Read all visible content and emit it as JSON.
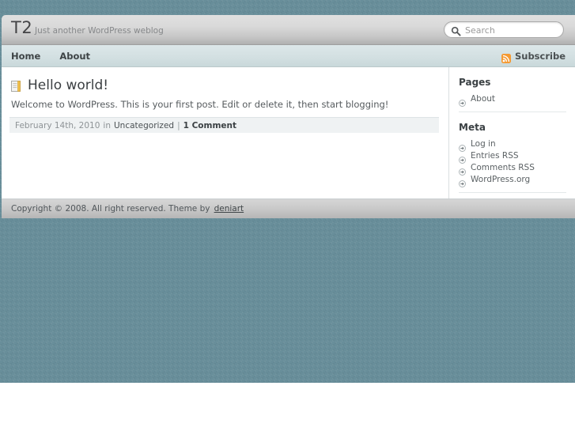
{
  "site": {
    "title": "T2",
    "tagline": "Just another WordPress weblog"
  },
  "search": {
    "placeholder": "Search",
    "value": "",
    "icon": "search-icon"
  },
  "nav": {
    "items": [
      {
        "label": "Home"
      },
      {
        "label": "About"
      }
    ],
    "subscribe": {
      "label": "Subscribe",
      "icon": "rss-icon",
      "color": "#f0841a"
    }
  },
  "post": {
    "icon": "book-icon",
    "title": "Hello world!",
    "excerpt": "Welcome to WordPress. This is your first post. Edit or delete it, then start blogging!",
    "meta": {
      "date": "February 14th, 2010",
      "in_label": "in",
      "category": "Uncategorized",
      "separator": "|",
      "comments": "1 Comment"
    }
  },
  "sidebar": {
    "widgets": [
      {
        "title": "Pages",
        "items": [
          {
            "label": "About",
            "icon": "arrow-circle-icon"
          }
        ]
      },
      {
        "title": "Meta",
        "items": [
          {
            "label": "Log in",
            "icon": "arrow-circle-icon"
          },
          {
            "label": "Entries RSS",
            "icon": "arrow-circle-icon"
          },
          {
            "label": "Comments RSS",
            "icon": "arrow-circle-icon"
          },
          {
            "label": "WordPress.org",
            "icon": "arrow-circle-icon"
          }
        ]
      }
    ]
  },
  "footer": {
    "text": "Copyright © 2008. All right reserved. Theme by",
    "link": "deniart"
  },
  "colors": {
    "page_background": "#688e9a",
    "header_gradient_top": "#e0e0e0",
    "nav_background": "#d3e0e2",
    "accent_orange": "#f0841a"
  }
}
